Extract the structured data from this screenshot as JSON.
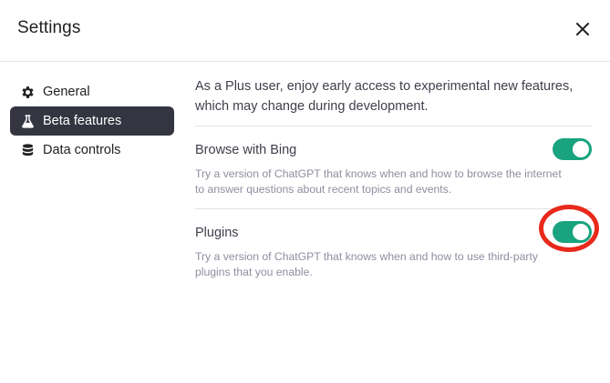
{
  "header": {
    "title": "Settings",
    "close_icon": "close-icon"
  },
  "sidebar": {
    "items": [
      {
        "label": "General",
        "icon": "gear-icon",
        "active": false
      },
      {
        "label": "Beta features",
        "icon": "flask-icon",
        "active": true
      },
      {
        "label": "Data controls",
        "icon": "database-icon",
        "active": false
      }
    ]
  },
  "main": {
    "intro": "As a Plus user, enjoy early access to experimental new features, which may change during development.",
    "features": [
      {
        "title": "Browse with Bing",
        "description": "Try a version of ChatGPT that knows when and how to browse the internet to answer questions about recent topics and events.",
        "enabled": true
      },
      {
        "title": "Plugins",
        "description": "Try a version of ChatGPT that knows when and how to use third-party plugins that you enable.",
        "enabled": true
      }
    ]
  },
  "colors": {
    "toggle_on": "#19a37f",
    "active_nav_bg": "#343541",
    "highlight_ring": "#e8291c"
  }
}
